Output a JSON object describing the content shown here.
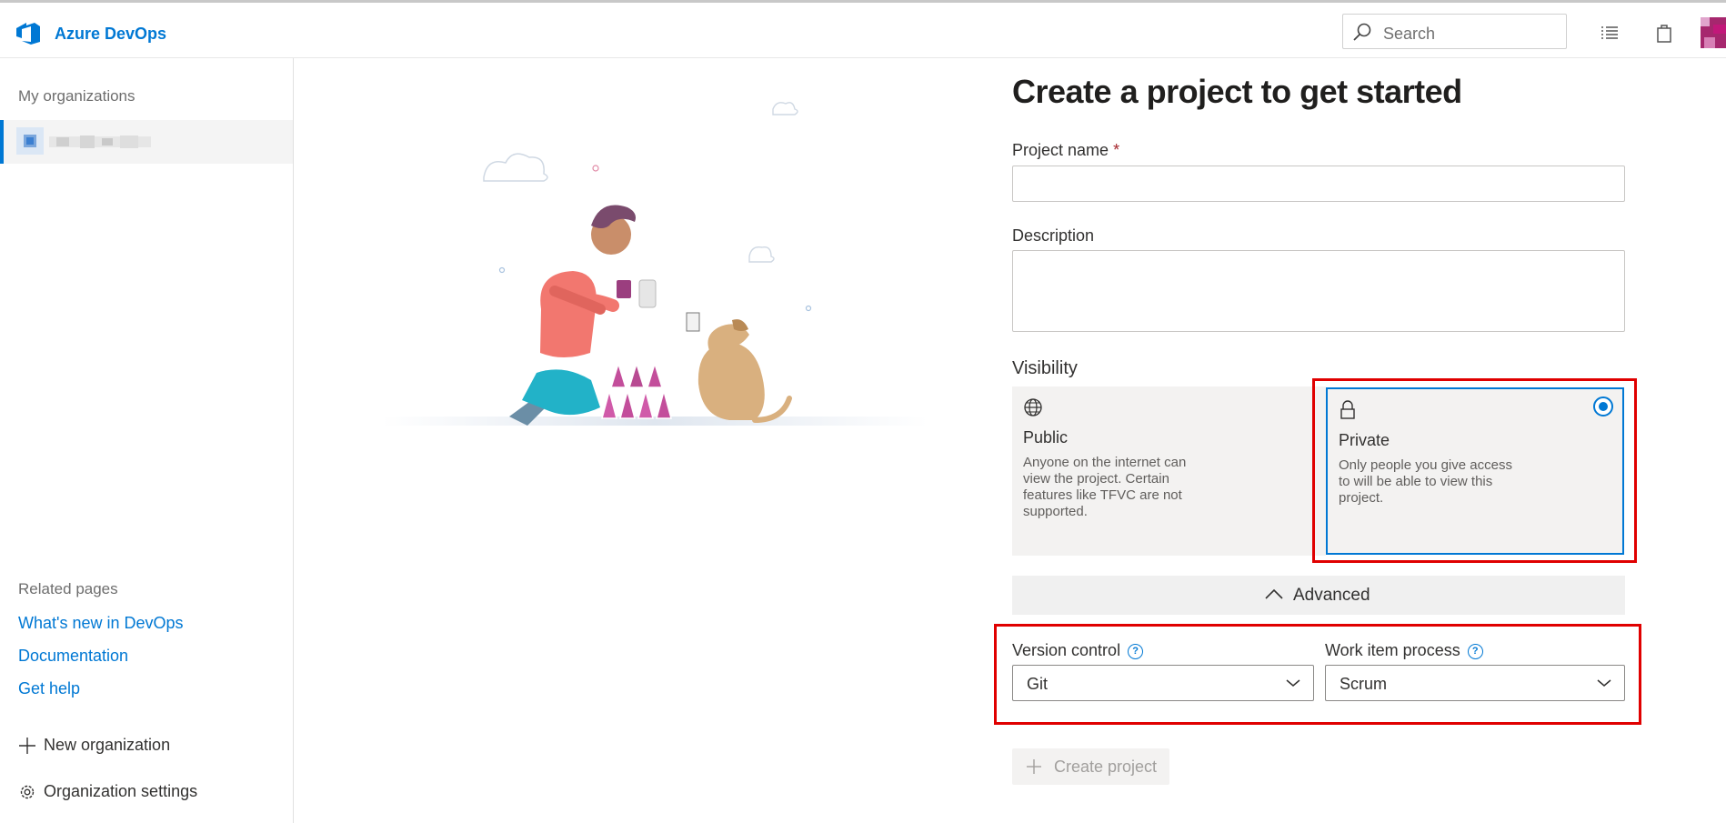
{
  "header": {
    "brand": "Azure DevOps",
    "search_placeholder": "Search",
    "icons": [
      "azure-devops-logo-icon",
      "search-icon",
      "work-items-icon",
      "marketplace-bag-icon"
    ],
    "accent_color": "#0078d4"
  },
  "sidebar": {
    "organizations_heading": "My organizations",
    "related_heading": "Related pages",
    "links": [
      {
        "label": "What's new in DevOps"
      },
      {
        "label": "Documentation"
      },
      {
        "label": "Get help"
      }
    ],
    "new_organization": "New organization",
    "organization_settings": "Organization settings"
  },
  "form": {
    "title": "Create a project to get started",
    "project_name_label": "Project name",
    "required_marker": "*",
    "project_name_value": "",
    "description_label": "Description",
    "description_value": "",
    "visibility_label": "Visibility",
    "visibility_options": [
      {
        "name": "Public",
        "description": "Anyone on the internet can view the project. Certain features like TFVC are not supported.",
        "icon": "globe-icon",
        "selected": false
      },
      {
        "name": "Private",
        "description": "Only people you give access to will be able to view this project.",
        "icon": "lock-icon",
        "selected": true
      }
    ],
    "advanced_label": "Advanced",
    "version_control_label": "Version control",
    "version_control_value": "Git",
    "work_item_process_label": "Work item process",
    "work_item_process_value": "Scrum",
    "create_button": "Create project",
    "help_glyph": "?"
  }
}
